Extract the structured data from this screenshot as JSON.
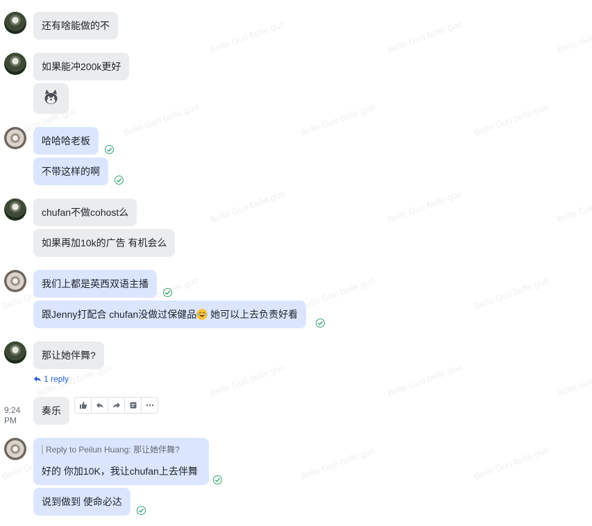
{
  "watermark": "Belle Guo belle.guo",
  "messages": [
    {
      "text": "还有啥能做的不"
    },
    {
      "text": "如果能冲200k更好"
    },
    {
      "text": "哈哈哈老板"
    },
    {
      "text": "不带这样的啊"
    },
    {
      "text": "chufan不做cohost么"
    },
    {
      "text": "如果再加10k的广告 有机会么"
    },
    {
      "text": "我们上都是英西双语主播"
    },
    {
      "text_before": "跟Jenny打配合 chufan没做过保健品",
      "text_after": " 她可以上去负责好看"
    },
    {
      "text": "那让她伴舞?"
    },
    {
      "text": "奏乐"
    },
    {
      "text": "好的 你加10K，我让chufan上去伴舞"
    },
    {
      "text": "说到做到 使命必达"
    }
  ],
  "thread": {
    "reply_count_label": "1 reply"
  },
  "hover": {
    "time": "9:24\nPM"
  },
  "quote": {
    "label": "Reply to Peilun Huang:",
    "text": "那让她伴舞?"
  },
  "colors": {
    "incoming": "#ebecee",
    "outgoing": "#dbe6fe",
    "read_check": "#2ea26c",
    "link": "#245bdb"
  },
  "icons": [
    "avatar",
    "read-check-icon",
    "reply-arrow-icon",
    "thumbs-up-icon",
    "reply-icon",
    "forward-icon",
    "pin-icon",
    "more-icon",
    "husky-sticker-icon",
    "laughing-emoji-icon"
  ]
}
